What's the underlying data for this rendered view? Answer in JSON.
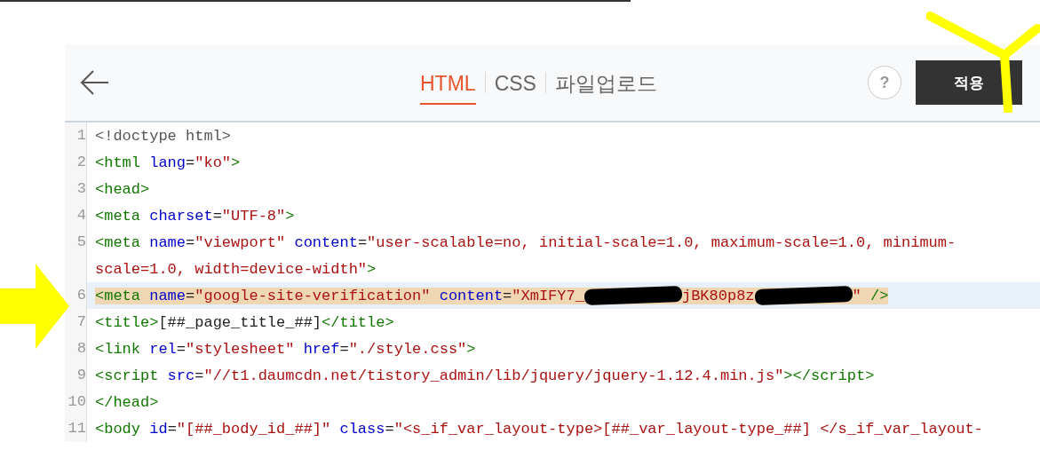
{
  "header": {
    "tabs": [
      {
        "label": "HTML",
        "selected": true
      },
      {
        "label": "CSS",
        "selected": false
      },
      {
        "label": "파일업로드",
        "selected": false
      }
    ],
    "help_label": "?",
    "apply_label": "적용"
  },
  "editor": {
    "lines": [
      {
        "number": "1",
        "selected": false,
        "tokens": [
          {
            "kind": "doctype",
            "text": "<!doctype html>"
          }
        ]
      },
      {
        "number": "2",
        "selected": false,
        "tokens": [
          {
            "kind": "tag",
            "text": "<html"
          },
          {
            "kind": "attr",
            "text": " lang"
          },
          {
            "kind": "plain",
            "text": "="
          },
          {
            "kind": "str",
            "text": "\"ko\""
          },
          {
            "kind": "tag",
            "text": ">"
          }
        ]
      },
      {
        "number": "3",
        "selected": false,
        "tokens": [
          {
            "kind": "tag",
            "text": "<head>"
          }
        ]
      },
      {
        "number": "4",
        "selected": false,
        "tokens": [
          {
            "kind": "tag",
            "text": "<meta"
          },
          {
            "kind": "attr",
            "text": " charset"
          },
          {
            "kind": "plain",
            "text": "="
          },
          {
            "kind": "str",
            "text": "\"UTF-8\""
          },
          {
            "kind": "tag",
            "text": ">"
          }
        ]
      },
      {
        "number": "5",
        "selected": false,
        "tokens": [
          {
            "kind": "tag",
            "text": "<meta"
          },
          {
            "kind": "attr",
            "text": " name"
          },
          {
            "kind": "plain",
            "text": "="
          },
          {
            "kind": "str",
            "text": "\"viewport\""
          },
          {
            "kind": "attr",
            "text": " content"
          },
          {
            "kind": "plain",
            "text": "="
          },
          {
            "kind": "str",
            "text": "\"user-scalable=no, initial-scale=1.0, maximum-scale=1.0, minimum-"
          }
        ]
      },
      {
        "selected": false,
        "tokens": [
          {
            "kind": "str",
            "text": "scale=1.0, width=device-width\""
          },
          {
            "kind": "tag",
            "text": ">"
          }
        ]
      },
      {
        "number": "6",
        "selected": true,
        "tokens": [
          {
            "kind": "tag",
            "text": "<meta"
          },
          {
            "kind": "attr",
            "text": " name"
          },
          {
            "kind": "plain",
            "text": "="
          },
          {
            "kind": "str",
            "text": "\"google-site-verification\""
          },
          {
            "kind": "attr",
            "text": " content"
          },
          {
            "kind": "plain",
            "text": "="
          },
          {
            "kind": "str",
            "text": "\"XmIFY7_"
          },
          {
            "kind": "redaction"
          },
          {
            "kind": "str",
            "text": "jBK80p8z"
          },
          {
            "kind": "redaction"
          },
          {
            "kind": "str",
            "text": "\""
          },
          {
            "kind": "tag",
            "text": " />"
          }
        ]
      },
      {
        "number": "7",
        "selected": false,
        "tokens": [
          {
            "kind": "tag",
            "text": "<title>"
          },
          {
            "kind": "plain",
            "text": "[##_page_title_##]"
          },
          {
            "kind": "tag",
            "text": "</title>"
          }
        ]
      },
      {
        "number": "8",
        "selected": false,
        "tokens": [
          {
            "kind": "tag",
            "text": "<link"
          },
          {
            "kind": "attr",
            "text": " rel"
          },
          {
            "kind": "plain",
            "text": "="
          },
          {
            "kind": "str",
            "text": "\"stylesheet\""
          },
          {
            "kind": "attr",
            "text": " href"
          },
          {
            "kind": "plain",
            "text": "="
          },
          {
            "kind": "str",
            "text": "\"./style.css\""
          },
          {
            "kind": "tag",
            "text": ">"
          }
        ]
      },
      {
        "number": "9",
        "selected": false,
        "tokens": [
          {
            "kind": "tag",
            "text": "<script"
          },
          {
            "kind": "attr",
            "text": " src"
          },
          {
            "kind": "plain",
            "text": "="
          },
          {
            "kind": "str",
            "text": "\"//t1.daumcdn.net/tistory_admin/lib/jquery/jquery-1.12.4.min.js\""
          },
          {
            "kind": "tag",
            "text": "></script>"
          }
        ]
      },
      {
        "number": "10",
        "selected": false,
        "tokens": [
          {
            "kind": "tag",
            "text": "</head>"
          }
        ]
      },
      {
        "number": "11",
        "selected": false,
        "tokens": [
          {
            "kind": "tag",
            "text": "<body"
          },
          {
            "kind": "attr",
            "text": " id"
          },
          {
            "kind": "plain",
            "text": "="
          },
          {
            "kind": "str",
            "text": "\"[##_body_id_##]\""
          },
          {
            "kind": "attr",
            "text": " class"
          },
          {
            "kind": "plain",
            "text": "="
          },
          {
            "kind": "str",
            "text": "\"<s_if_var_layout-type>[##_var_layout-type_##] </s_if_var_layout-"
          }
        ]
      }
    ]
  }
}
